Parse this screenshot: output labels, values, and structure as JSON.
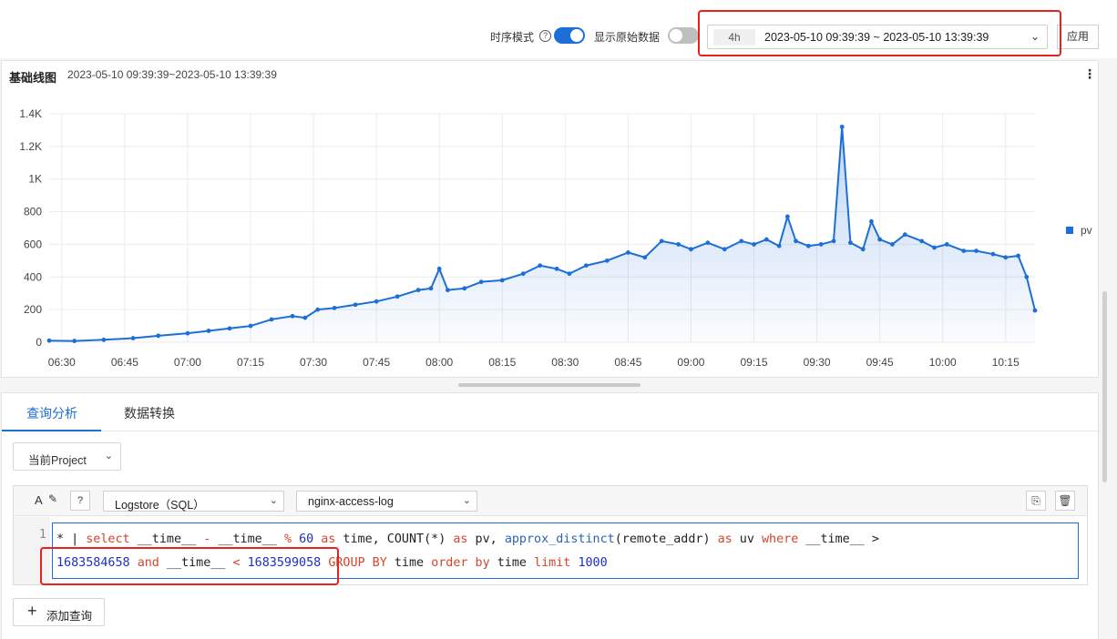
{
  "topbar": {
    "timeseries_label": "时序模式",
    "help_glyph": "?",
    "raw_data_label": "显示原始数据",
    "time_badge": "4h",
    "time_range": "2023-05-10 09:39:39 ~ 2023-05-10 13:39:39",
    "apply_label": "应用",
    "timeseries_on": true,
    "raw_data_on": false
  },
  "chart_panel": {
    "title": "基础线图",
    "range": "2023-05-10 09:39:39~2023-05-10 13:39:39",
    "menu_glyph": "⋮"
  },
  "chart_data": {
    "type": "area",
    "title": "基础线图",
    "xlabel": "",
    "ylabel": "",
    "x_ticks": [
      "06:30",
      "06:45",
      "07:00",
      "07:15",
      "07:30",
      "07:45",
      "08:00",
      "08:15",
      "08:30",
      "08:45",
      "09:00",
      "09:15",
      "09:30",
      "09:45",
      "10:00",
      "10:15"
    ],
    "y_ticks": [
      "0",
      "200",
      "400",
      "600",
      "800",
      "1K",
      "1.2K",
      "1.4K"
    ],
    "ylim": [
      0,
      1400
    ],
    "xlim": [
      "06:27",
      "10:22"
    ],
    "legend_position": "right",
    "grid": true,
    "color": "#1d6fd8",
    "series": [
      {
        "name": "pv",
        "points": [
          [
            "06:27",
            10
          ],
          [
            "06:33",
            8
          ],
          [
            "06:40",
            15
          ],
          [
            "06:47",
            25
          ],
          [
            "06:53",
            40
          ],
          [
            "07:00",
            55
          ],
          [
            "07:05",
            70
          ],
          [
            "07:10",
            85
          ],
          [
            "07:15",
            100
          ],
          [
            "07:20",
            140
          ],
          [
            "07:25",
            160
          ],
          [
            "07:28",
            150
          ],
          [
            "07:31",
            200
          ],
          [
            "07:35",
            210
          ],
          [
            "07:40",
            230
          ],
          [
            "07:45",
            250
          ],
          [
            "07:50",
            280
          ],
          [
            "07:55",
            320
          ],
          [
            "07:58",
            330
          ],
          [
            "08:00",
            450
          ],
          [
            "08:02",
            320
          ],
          [
            "08:06",
            330
          ],
          [
            "08:10",
            370
          ],
          [
            "08:15",
            380
          ],
          [
            "08:20",
            420
          ],
          [
            "08:24",
            470
          ],
          [
            "08:28",
            450
          ],
          [
            "08:31",
            420
          ],
          [
            "08:35",
            470
          ],
          [
            "08:40",
            500
          ],
          [
            "08:45",
            550
          ],
          [
            "08:49",
            520
          ],
          [
            "08:53",
            620
          ],
          [
            "08:57",
            600
          ],
          [
            "09:00",
            570
          ],
          [
            "09:04",
            610
          ],
          [
            "09:08",
            570
          ],
          [
            "09:12",
            620
          ],
          [
            "09:15",
            600
          ],
          [
            "09:18",
            630
          ],
          [
            "09:21",
            590
          ],
          [
            "09:23",
            770
          ],
          [
            "09:25",
            620
          ],
          [
            "09:28",
            590
          ],
          [
            "09:31",
            600
          ],
          [
            "09:34",
            620
          ],
          [
            "09:36",
            1320
          ],
          [
            "09:38",
            610
          ],
          [
            "09:41",
            570
          ],
          [
            "09:43",
            740
          ],
          [
            "09:45",
            630
          ],
          [
            "09:48",
            600
          ],
          [
            "09:51",
            660
          ],
          [
            "09:55",
            620
          ],
          [
            "09:58",
            580
          ],
          [
            "10:01",
            600
          ],
          [
            "10:05",
            560
          ],
          [
            "10:08",
            560
          ],
          [
            "10:12",
            540
          ],
          [
            "10:15",
            520
          ],
          [
            "10:18",
            530
          ],
          [
            "10:20",
            400
          ],
          [
            "10:22",
            195
          ]
        ]
      }
    ]
  },
  "tabs": {
    "items": [
      "查询分析",
      "数据转换"
    ],
    "active": 0
  },
  "query": {
    "project_select": "当前Project",
    "format_glyph": "A",
    "logstore_type": "Logstore（SQL）",
    "logstore_name": "nginx-access-log",
    "line_number": "1",
    "line1": [
      {
        "text": "* | ",
        "kind": "t"
      },
      {
        "text": "select",
        "kind": "k"
      },
      {
        "text": " __time__ ",
        "kind": "t"
      },
      {
        "text": "-",
        "kind": "k"
      },
      {
        "text": " __time__ ",
        "kind": "t"
      },
      {
        "text": "%",
        "kind": "k"
      },
      {
        "text": " ",
        "kind": "t"
      },
      {
        "text": "60",
        "kind": "n"
      },
      {
        "text": " ",
        "kind": "t"
      },
      {
        "text": "as",
        "kind": "k"
      },
      {
        "text": " time, COUNT(*) ",
        "kind": "t"
      },
      {
        "text": "as",
        "kind": "k"
      },
      {
        "text": " pv, ",
        "kind": "t"
      },
      {
        "text": "approx_distinct",
        "kind": "f"
      },
      {
        "text": "(remote_addr) ",
        "kind": "t"
      },
      {
        "text": "as",
        "kind": "k"
      },
      {
        "text": " uv ",
        "kind": "t"
      },
      {
        "text": "where",
        "kind": "k"
      },
      {
        "text": " __time__ >",
        "kind": "t"
      }
    ],
    "line2": [
      {
        "text": "1683584658",
        "kind": "n"
      },
      {
        "text": " ",
        "kind": "t"
      },
      {
        "text": "and",
        "kind": "k"
      },
      {
        "text": " __time__ ",
        "kind": "t"
      },
      {
        "text": "<",
        "kind": "k"
      },
      {
        "text": " ",
        "kind": "t"
      },
      {
        "text": "1683599058",
        "kind": "n"
      },
      {
        "text": " ",
        "kind": "t"
      },
      {
        "text": "GROUP BY",
        "kind": "k"
      },
      {
        "text": " time ",
        "kind": "t"
      },
      {
        "text": "order by",
        "kind": "k"
      },
      {
        "text": " time ",
        "kind": "t"
      },
      {
        "text": "limit",
        "kind": "k"
      },
      {
        "text": " ",
        "kind": "t"
      },
      {
        "text": "1000",
        "kind": "n"
      }
    ],
    "add_query_label": "添加查询"
  }
}
